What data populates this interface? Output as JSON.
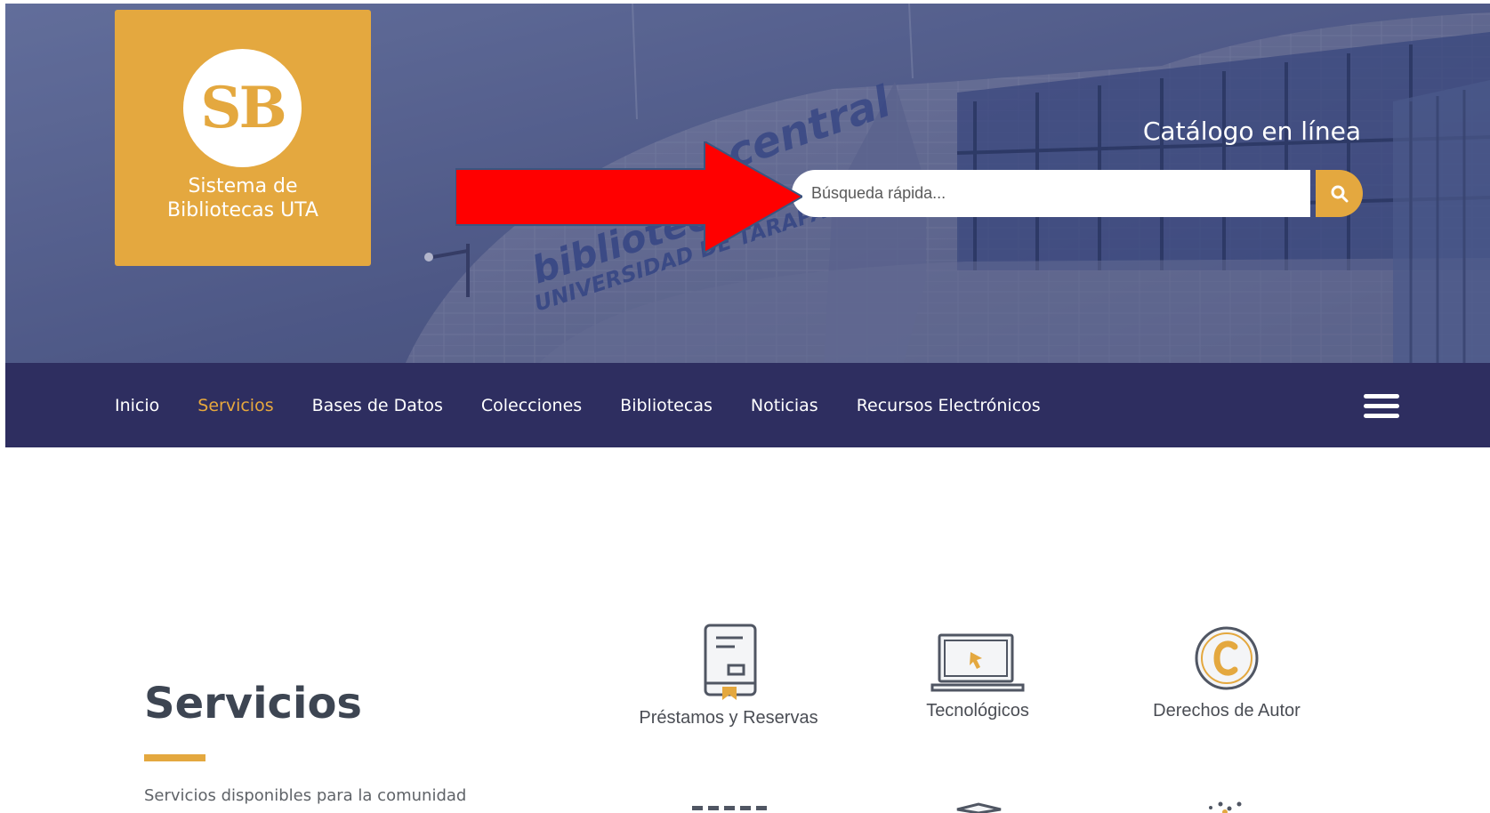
{
  "colors": {
    "brand_gold": "#e4a83f",
    "nav_background": "#2e2e60",
    "hero_overlay": "#4f5a87",
    "annotation_arrow": "#ff0000",
    "active_nav_text": "#e7a83d"
  },
  "header": {
    "logo": {
      "monogram": "SB",
      "caption_line1": "Sistema de",
      "caption_line2": "Bibliotecas UTA"
    },
    "catalog_title": "Catálogo en línea",
    "search": {
      "placeholder": "Búsqueda rápida...",
      "icon": "search-icon"
    },
    "annotation": {
      "type": "arrow",
      "direction": "right",
      "color": "#ff0000"
    }
  },
  "nav": {
    "items": [
      {
        "label": "Inicio",
        "active": false
      },
      {
        "label": "Servicios",
        "active": true
      },
      {
        "label": "Bases de Datos",
        "active": false
      },
      {
        "label": "Colecciones",
        "active": false
      },
      {
        "label": "Bibliotecas",
        "active": false
      },
      {
        "label": "Noticias",
        "active": false
      },
      {
        "label": "Recursos Electrónicos",
        "active": false
      }
    ],
    "menu_icon": "hamburger-menu-icon"
  },
  "content": {
    "title": "Servicios",
    "description": "Servicios disponibles para la comunidad",
    "services": [
      {
        "label": "Préstamos y Reservas",
        "icon": "book-bookmark-icon"
      },
      {
        "label": "Tecnológicos",
        "icon": "laptop-cursor-icon"
      },
      {
        "label": "Derechos de Autor",
        "icon": "copyright-icon"
      }
    ]
  }
}
